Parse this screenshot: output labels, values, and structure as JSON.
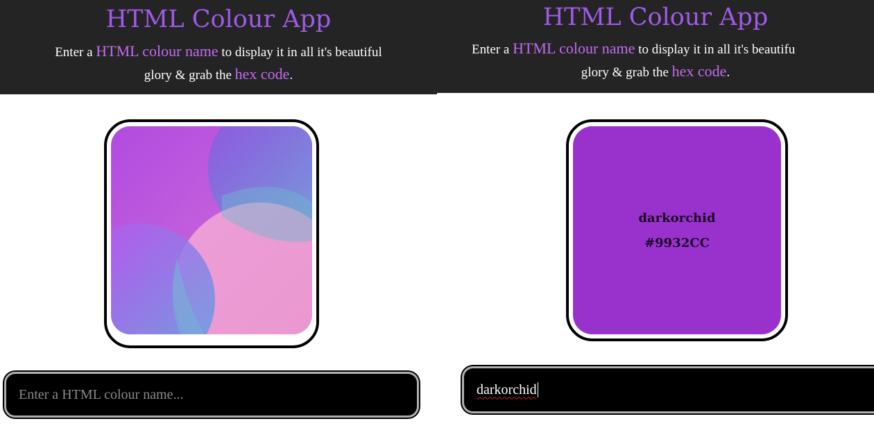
{
  "colors": {
    "header_bg": "#242424",
    "accent": "#9f5be8",
    "highlight": "#c46bf0",
    "input_bg": "#000000"
  },
  "left_panel": {
    "title": "HTML Colour App",
    "subtitle": {
      "pre1": "Enter a ",
      "hl1": "HTML colour name",
      "post1": " to display it in all it's beautiful",
      "pre2": "glory & grab the ",
      "hl2": "hex code",
      "post2": "."
    },
    "swatch_icon": "gradient-circles-placeholder",
    "input": {
      "value": "",
      "placeholder": "Enter a HTML colour name..."
    }
  },
  "right_panel": {
    "title": "HTML Colour App",
    "subtitle": {
      "pre1": "Enter a ",
      "hl1": "HTML colour name",
      "post1": " to display it in all it's beautifu",
      "pre2": "glory & grab the ",
      "hl2": "hex code",
      "post2": "."
    },
    "swatch": {
      "color": "#9932CC",
      "name": "darkorchid",
      "hex": "#9932CC"
    },
    "input": {
      "value": "darkorchid"
    }
  }
}
